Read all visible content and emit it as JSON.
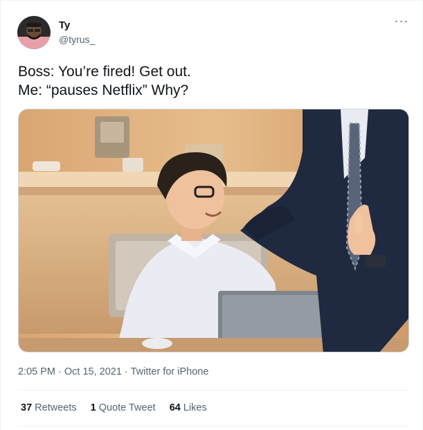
{
  "author": {
    "display_name": "Ty",
    "handle": "@tyrus_"
  },
  "more_glyph": "···",
  "tweet": {
    "lines": [
      "Boss: You’re fired! Get out.",
      "Me: “pauses Netflix” Why?"
    ]
  },
  "meta": {
    "time": "2:05 PM",
    "date": "Oct 15, 2021",
    "separator": "·",
    "source": "Twitter for iPhone"
  },
  "stats": [
    {
      "count": "37",
      "label": "Retweets"
    },
    {
      "count": "1",
      "label": "Quote Tweet"
    },
    {
      "count": "64",
      "label": "Likes"
    }
  ]
}
